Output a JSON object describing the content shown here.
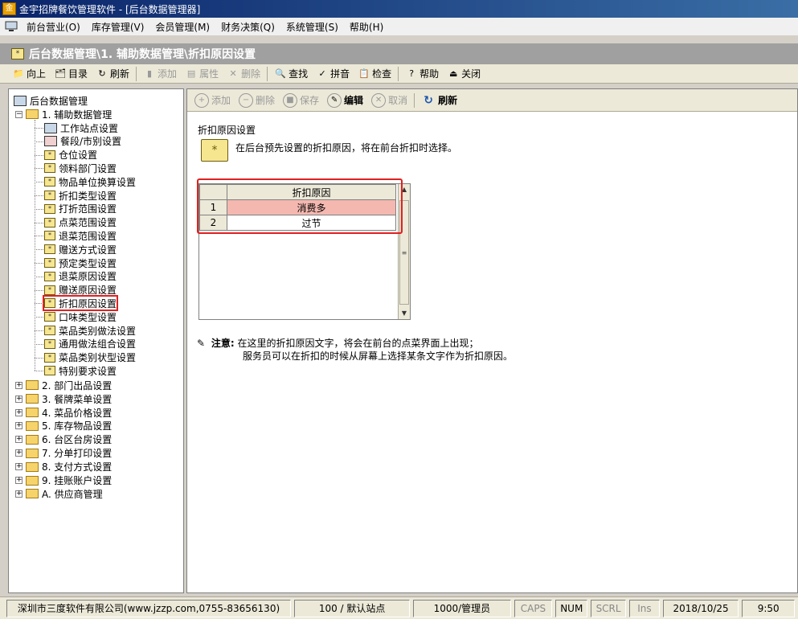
{
  "window": {
    "title": "金宇招牌餐饮管理软件 - [后台数据管理器]",
    "app_icon": "金"
  },
  "menu": [
    "前台营业(O)",
    "库存管理(V)",
    "会员管理(M)",
    "财务决策(Q)",
    "系统管理(S)",
    "帮助(H)"
  ],
  "header": {
    "title": "后台数据管理\\1. 辅助数据管理\\折扣原因设置"
  },
  "toolbar": {
    "up": "向上",
    "catalog": "目录",
    "refresh": "刷新",
    "add": "添加",
    "props": "属性",
    "delete": "删除",
    "find": "查找",
    "pinyin": "拼音",
    "check": "检查",
    "help": "帮助",
    "close": "关闭"
  },
  "tree": {
    "root": "后台数据管理",
    "group1": "1. 辅助数据管理",
    "children": [
      "工作站点设置",
      "餐段/市别设置",
      "仓位设置",
      "领料部门设置",
      "物品单位换算设置",
      "折扣类型设置",
      "打折范围设置",
      "点菜范围设置",
      "退菜范围设置",
      "赠送方式设置",
      "预定类型设置",
      "退菜原因设置",
      "赠送原因设置",
      "折扣原因设置",
      "口味类型设置",
      "菜品类别做法设置",
      "通用做法组合设置",
      "菜品类别状型设置",
      "特别要求设置"
    ],
    "groups": [
      "2. 部门出品设置",
      "3. 餐牌菜单设置",
      "4. 菜品价格设置",
      "5. 库存物品设置",
      "6. 台区台房设置",
      "7. 分单打印设置",
      "8. 支付方式设置",
      "9. 挂账账户设置",
      "A. 供应商管理"
    ]
  },
  "right_toolbar": {
    "add": "添加",
    "delete": "删除",
    "save": "保存",
    "edit": "编辑",
    "cancel": "取消",
    "refresh": "刷新"
  },
  "section": {
    "title": "折扣原因设置",
    "description": "在后台预先设置的折扣原因，将在前台折扣时选择。"
  },
  "grid": {
    "header": "折扣原因",
    "rows": [
      {
        "num": "1",
        "value": "消费多"
      },
      {
        "num": "2",
        "value": "过节"
      }
    ]
  },
  "note": {
    "label": "注意:",
    "line1": "在这里的折扣原因文字，将会在前台的点菜界面上出现；",
    "line2": "服务员可以在折扣的时候从屏幕上选择某条文字作为折扣原因。"
  },
  "status": {
    "company": "深圳市三度软件有限公司(www.jzzp.com,0755-83656130)",
    "station": "100 / 默认站点",
    "user": "1000/管理员",
    "caps": "CAPS",
    "num": "NUM",
    "scrl": "SCRL",
    "ins": "Ins",
    "date": "2018/10/25",
    "time": "9:50"
  },
  "colors": {
    "highlight": "#e02020",
    "selected_row": "#f4b8b0"
  }
}
